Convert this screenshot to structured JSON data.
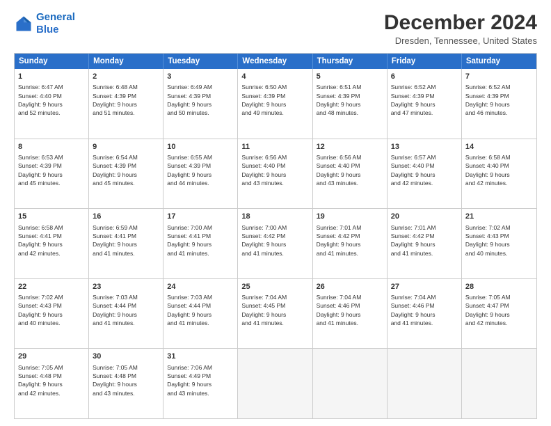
{
  "logo": {
    "line1": "General",
    "line2": "Blue"
  },
  "title": "December 2024",
  "subtitle": "Dresden, Tennessee, United States",
  "header_days": [
    "Sunday",
    "Monday",
    "Tuesday",
    "Wednesday",
    "Thursday",
    "Friday",
    "Saturday"
  ],
  "rows": [
    [
      {
        "day": "1",
        "lines": [
          "Sunrise: 6:47 AM",
          "Sunset: 4:40 PM",
          "Daylight: 9 hours",
          "and 52 minutes."
        ]
      },
      {
        "day": "2",
        "lines": [
          "Sunrise: 6:48 AM",
          "Sunset: 4:39 PM",
          "Daylight: 9 hours",
          "and 51 minutes."
        ]
      },
      {
        "day": "3",
        "lines": [
          "Sunrise: 6:49 AM",
          "Sunset: 4:39 PM",
          "Daylight: 9 hours",
          "and 50 minutes."
        ]
      },
      {
        "day": "4",
        "lines": [
          "Sunrise: 6:50 AM",
          "Sunset: 4:39 PM",
          "Daylight: 9 hours",
          "and 49 minutes."
        ]
      },
      {
        "day": "5",
        "lines": [
          "Sunrise: 6:51 AM",
          "Sunset: 4:39 PM",
          "Daylight: 9 hours",
          "and 48 minutes."
        ]
      },
      {
        "day": "6",
        "lines": [
          "Sunrise: 6:52 AM",
          "Sunset: 4:39 PM",
          "Daylight: 9 hours",
          "and 47 minutes."
        ]
      },
      {
        "day": "7",
        "lines": [
          "Sunrise: 6:52 AM",
          "Sunset: 4:39 PM",
          "Daylight: 9 hours",
          "and 46 minutes."
        ]
      }
    ],
    [
      {
        "day": "8",
        "lines": [
          "Sunrise: 6:53 AM",
          "Sunset: 4:39 PM",
          "Daylight: 9 hours",
          "and 45 minutes."
        ]
      },
      {
        "day": "9",
        "lines": [
          "Sunrise: 6:54 AM",
          "Sunset: 4:39 PM",
          "Daylight: 9 hours",
          "and 45 minutes."
        ]
      },
      {
        "day": "10",
        "lines": [
          "Sunrise: 6:55 AM",
          "Sunset: 4:39 PM",
          "Daylight: 9 hours",
          "and 44 minutes."
        ]
      },
      {
        "day": "11",
        "lines": [
          "Sunrise: 6:56 AM",
          "Sunset: 4:40 PM",
          "Daylight: 9 hours",
          "and 43 minutes."
        ]
      },
      {
        "day": "12",
        "lines": [
          "Sunrise: 6:56 AM",
          "Sunset: 4:40 PM",
          "Daylight: 9 hours",
          "and 43 minutes."
        ]
      },
      {
        "day": "13",
        "lines": [
          "Sunrise: 6:57 AM",
          "Sunset: 4:40 PM",
          "Daylight: 9 hours",
          "and 42 minutes."
        ]
      },
      {
        "day": "14",
        "lines": [
          "Sunrise: 6:58 AM",
          "Sunset: 4:40 PM",
          "Daylight: 9 hours",
          "and 42 minutes."
        ]
      }
    ],
    [
      {
        "day": "15",
        "lines": [
          "Sunrise: 6:58 AM",
          "Sunset: 4:41 PM",
          "Daylight: 9 hours",
          "and 42 minutes."
        ]
      },
      {
        "day": "16",
        "lines": [
          "Sunrise: 6:59 AM",
          "Sunset: 4:41 PM",
          "Daylight: 9 hours",
          "and 41 minutes."
        ]
      },
      {
        "day": "17",
        "lines": [
          "Sunrise: 7:00 AM",
          "Sunset: 4:41 PM",
          "Daylight: 9 hours",
          "and 41 minutes."
        ]
      },
      {
        "day": "18",
        "lines": [
          "Sunrise: 7:00 AM",
          "Sunset: 4:42 PM",
          "Daylight: 9 hours",
          "and 41 minutes."
        ]
      },
      {
        "day": "19",
        "lines": [
          "Sunrise: 7:01 AM",
          "Sunset: 4:42 PM",
          "Daylight: 9 hours",
          "and 41 minutes."
        ]
      },
      {
        "day": "20",
        "lines": [
          "Sunrise: 7:01 AM",
          "Sunset: 4:42 PM",
          "Daylight: 9 hours",
          "and 41 minutes."
        ]
      },
      {
        "day": "21",
        "lines": [
          "Sunrise: 7:02 AM",
          "Sunset: 4:43 PM",
          "Daylight: 9 hours",
          "and 40 minutes."
        ]
      }
    ],
    [
      {
        "day": "22",
        "lines": [
          "Sunrise: 7:02 AM",
          "Sunset: 4:43 PM",
          "Daylight: 9 hours",
          "and 40 minutes."
        ]
      },
      {
        "day": "23",
        "lines": [
          "Sunrise: 7:03 AM",
          "Sunset: 4:44 PM",
          "Daylight: 9 hours",
          "and 41 minutes."
        ]
      },
      {
        "day": "24",
        "lines": [
          "Sunrise: 7:03 AM",
          "Sunset: 4:44 PM",
          "Daylight: 9 hours",
          "and 41 minutes."
        ]
      },
      {
        "day": "25",
        "lines": [
          "Sunrise: 7:04 AM",
          "Sunset: 4:45 PM",
          "Daylight: 9 hours",
          "and 41 minutes."
        ]
      },
      {
        "day": "26",
        "lines": [
          "Sunrise: 7:04 AM",
          "Sunset: 4:46 PM",
          "Daylight: 9 hours",
          "and 41 minutes."
        ]
      },
      {
        "day": "27",
        "lines": [
          "Sunrise: 7:04 AM",
          "Sunset: 4:46 PM",
          "Daylight: 9 hours",
          "and 41 minutes."
        ]
      },
      {
        "day": "28",
        "lines": [
          "Sunrise: 7:05 AM",
          "Sunset: 4:47 PM",
          "Daylight: 9 hours",
          "and 42 minutes."
        ]
      }
    ],
    [
      {
        "day": "29",
        "lines": [
          "Sunrise: 7:05 AM",
          "Sunset: 4:48 PM",
          "Daylight: 9 hours",
          "and 42 minutes."
        ]
      },
      {
        "day": "30",
        "lines": [
          "Sunrise: 7:05 AM",
          "Sunset: 4:48 PM",
          "Daylight: 9 hours",
          "and 43 minutes."
        ]
      },
      {
        "day": "31",
        "lines": [
          "Sunrise: 7:06 AM",
          "Sunset: 4:49 PM",
          "Daylight: 9 hours",
          "and 43 minutes."
        ]
      },
      null,
      null,
      null,
      null
    ]
  ]
}
